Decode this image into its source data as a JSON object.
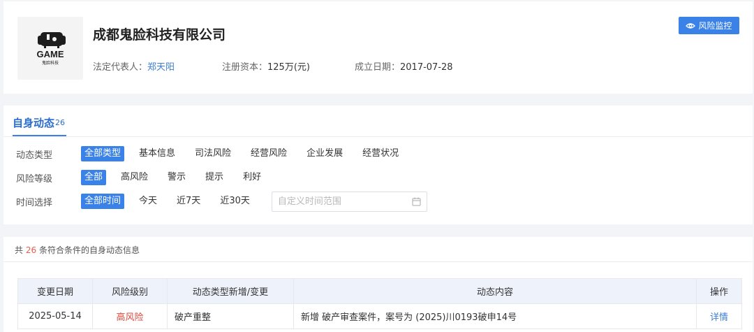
{
  "company": {
    "logo_text": "GAME",
    "logo_subtext": "鬼脸科技",
    "name": "成都鬼脸科技有限公司",
    "legal_rep_label": "法定代表人：",
    "legal_rep": "郑天阳",
    "capital_label": "注册资本：",
    "capital": "125万(元)",
    "founded_label": "成立日期：",
    "founded": "2017-07-28",
    "monitor_button": "风险监控"
  },
  "tab": {
    "label": "自身动态",
    "count": "26"
  },
  "filters": {
    "type": {
      "label": "动态类型",
      "options": [
        "全部类型",
        "基本信息",
        "司法风险",
        "经营风险",
        "企业发展",
        "经营状况"
      ]
    },
    "risk": {
      "label": "风险等级",
      "options": [
        "全部",
        "高风险",
        "警示",
        "提示",
        "利好"
      ]
    },
    "time": {
      "label": "时间选择",
      "options": [
        "全部时间",
        "今天",
        "近7天",
        "近30天"
      ],
      "custom_placeholder": "自定义时间范围"
    }
  },
  "results": {
    "prefix": "共",
    "count": "26",
    "suffix": "条符合条件的自身动态信息"
  },
  "table": {
    "headers": [
      "变更日期",
      "风险级别",
      "动态类型新增/变更",
      "动态内容",
      "操作"
    ],
    "rows": [
      {
        "date": "2025-05-14",
        "risk": "高风险",
        "type": "破产重整",
        "content": "新增 破产审查案件，案号为 (2025)川0193破申14号",
        "action": "详情"
      }
    ]
  },
  "colors": {
    "accent": "#3b82e8",
    "risk_high": "#e0473a",
    "link": "#3b7ed8"
  }
}
